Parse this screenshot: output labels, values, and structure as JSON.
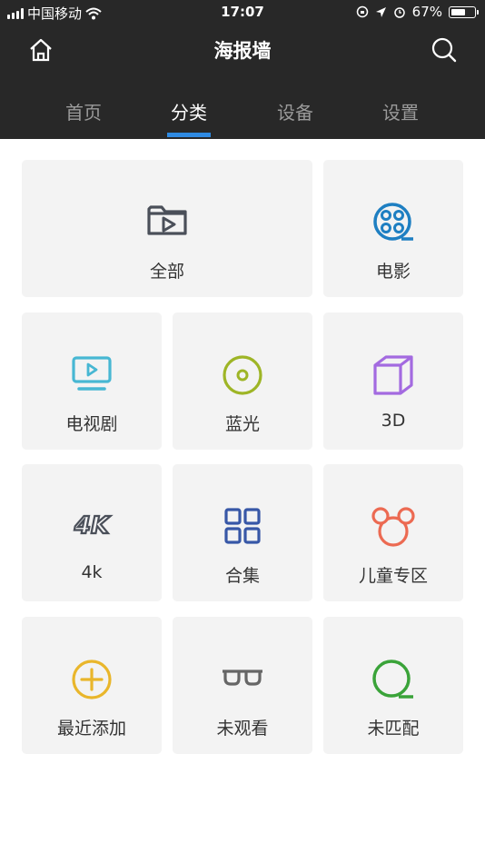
{
  "status_bar": {
    "carrier": "中国移动",
    "time": "17:07",
    "battery": "67%",
    "battery_level": 0.67
  },
  "header": {
    "title": "海报墙"
  },
  "tabs": [
    {
      "label": "首页",
      "active": false
    },
    {
      "label": "分类",
      "active": true
    },
    {
      "label": "设备",
      "active": false
    },
    {
      "label": "设置",
      "active": false
    }
  ],
  "categories": [
    {
      "label": "全部",
      "icon": "folder-play-icon",
      "color": "#4a4f59"
    },
    {
      "label": "电影",
      "icon": "film-reel-icon",
      "color": "#1e7fc2"
    },
    {
      "label": "电视剧",
      "icon": "tv-icon",
      "color": "#47b7d3"
    },
    {
      "label": "蓝光",
      "icon": "disc-icon",
      "color": "#9eb526"
    },
    {
      "label": "3D",
      "icon": "cube-icon",
      "color": "#a36ae0"
    },
    {
      "label": "4k",
      "icon": "4k-icon",
      "color": "#4a4f59"
    },
    {
      "label": "合集",
      "icon": "grid-icon",
      "color": "#3757a7"
    },
    {
      "label": "儿童专区",
      "icon": "mouse-ears-icon",
      "color": "#ec6a52"
    },
    {
      "label": "最近添加",
      "icon": "plus-circle-icon",
      "color": "#e9b62b"
    },
    {
      "label": "未观看",
      "icon": "glasses-icon",
      "color": "#666666"
    },
    {
      "label": "未匹配",
      "icon": "q-icon",
      "color": "#3aa339"
    }
  ]
}
